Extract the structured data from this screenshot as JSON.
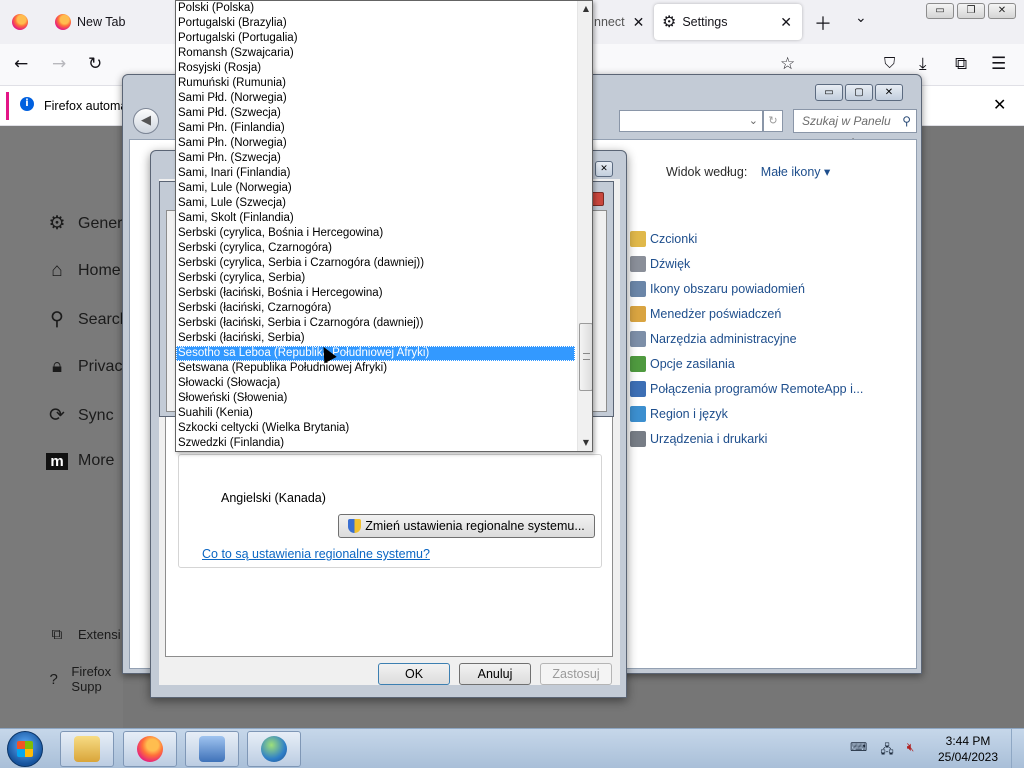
{
  "firefox": {
    "tabs": [
      {
        "label": "",
        "icon": "firefox-icon"
      },
      {
        "label": "New Tab",
        "icon": "firefox-icon"
      },
      {
        "label": "nnect",
        "icon": ""
      },
      {
        "label": "Settings",
        "icon": "gear-icon"
      }
    ],
    "notification": "Firefox automa",
    "sidebar": [
      {
        "label": "Gener",
        "icon": "gear-icon"
      },
      {
        "label": "Home",
        "icon": "home-icon"
      },
      {
        "label": "Search",
        "icon": "search-icon"
      },
      {
        "label": "Privac",
        "icon": "lock-icon"
      },
      {
        "label": "Sync",
        "icon": "sync-icon"
      },
      {
        "label": "More",
        "icon": "mozilla-icon"
      }
    ],
    "sidebar_bottom": [
      {
        "label": "Extensi",
        "icon": "puzzle-icon"
      },
      {
        "label": "Firefox Supp",
        "icon": "help-icon"
      }
    ]
  },
  "control_panel": {
    "search_placeholder": "Szukaj w Panelu sterowania",
    "view_by_label": "Widok według:",
    "view_by_value": "Małe ikony",
    "items": [
      {
        "label": "Czcionki",
        "color": "#e0b84a"
      },
      {
        "label": "Dźwięk",
        "color": "#8a8f99"
      },
      {
        "label": "Ikony obszaru powiadomień",
        "color": "#6b86a8"
      },
      {
        "label": "Menedżer poświadczeń",
        "color": "#d9a441"
      },
      {
        "label": "Narzędzia administracyjne",
        "color": "#7d8fa8"
      },
      {
        "label": "Opcje zasilania",
        "color": "#4f9a3f"
      },
      {
        "label": "Połączenia programów RemoteApp i...",
        "color": "#3d6fb5"
      },
      {
        "label": "Region i język",
        "color": "#3c8fcf"
      },
      {
        "label": "Urządzenia i drukarki",
        "color": "#777d86"
      }
    ]
  },
  "region_dialog": {
    "current_language": "Angielski (Kanada)",
    "change_button": "Zmień ustawienia regionalne systemu...",
    "help_link": "Co to są ustawienia regionalne systemu?",
    "ok": "OK",
    "cancel": "Anuluj",
    "apply": "Zastosuj"
  },
  "dropdown": {
    "selected_index": 23,
    "items": [
      "Polski (Polska)",
      "Portugalski (Brazylia)",
      "Portugalski (Portugalia)",
      "Romansh (Szwajcaria)",
      "Rosyjski (Rosja)",
      "Rumuński (Rumunia)",
      "Sami Płd. (Norwegia)",
      "Sami Płd. (Szwecja)",
      "Sami Płn. (Finlandia)",
      "Sami Płn. (Norwegia)",
      "Sami Płn. (Szwecja)",
      "Sami, Inari (Finlandia)",
      "Sami, Lule (Norwegia)",
      "Sami, Lule (Szwecja)",
      "Sami, Skolt (Finlandia)",
      "Serbski (cyrylica, Bośnia i Hercegowina)",
      "Serbski (cyrylica, Czarnogóra)",
      "Serbski (cyrylica, Serbia i Czarnogóra (dawniej))",
      "Serbski (cyrylica, Serbia)",
      "Serbski (łaciński, Bośnia i Hercegowina)",
      "Serbski (łaciński, Czarnogóra)",
      "Serbski (łaciński, Serbia i Czarnogóra (dawniej))",
      "Serbski (łaciński, Serbia)",
      "Sesotho sa Leboa (Republika Południowej Afryki)",
      "Setswana (Republika Południowej Afryki)",
      "Słowacki (Słowacja)",
      "Słoweński (Słowenia)",
      "Suahili (Kenia)",
      "Szkocki celtycki (Wielka Brytania)",
      "Szwedzki (Finlandia)"
    ]
  },
  "taskbar": {
    "apps": [
      {
        "name": "explorer",
        "color": "#e8c25a"
      },
      {
        "name": "firefox",
        "color": "#ff7139"
      },
      {
        "name": "control-panel",
        "color": "#5a8fd0"
      },
      {
        "name": "region",
        "color": "#3c8fcf"
      }
    ],
    "time": "3:44 PM",
    "date": "25/04/2023"
  }
}
